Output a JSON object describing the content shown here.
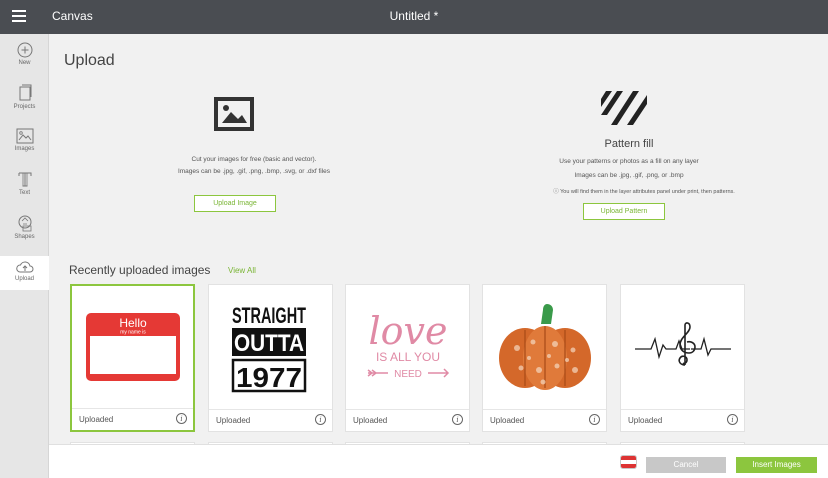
{
  "topbar": {
    "app_title": "Canvas",
    "doc_title": "Untitled *"
  },
  "sidebar": {
    "items": [
      {
        "label": "New",
        "icon": "plus-circle-icon"
      },
      {
        "label": "Projects",
        "icon": "projects-icon"
      },
      {
        "label": "Images",
        "icon": "images-icon"
      },
      {
        "label": "Text",
        "icon": "text-icon"
      },
      {
        "label": "Shapes",
        "icon": "shapes-icon"
      },
      {
        "label": "Upload",
        "icon": "upload-cloud-icon",
        "active": true
      }
    ]
  },
  "main": {
    "title": "Upload",
    "upload_image": {
      "desc1": "Cut your images for free (basic and vector).",
      "desc2": "Images can be .jpg, .gif, .png, .bmp, .svg, or .dxf files",
      "button": "Upload Image"
    },
    "pattern": {
      "title": "Pattern fill",
      "desc1": "Use your patterns or photos as a fill on any layer",
      "desc2": "Images can be .jpg, .gif, .png, or .bmp",
      "note": "ⓘ You will find them in the layer attributes panel under print, then patterns.",
      "button": "Upload Pattern"
    },
    "recent": {
      "title": "Recently uploaded images",
      "view_all": "View All",
      "cards": [
        {
          "label": "Uploaded",
          "selected": true,
          "image": "hello-name-tag",
          "hello_text": "Hello",
          "hello_sub": "my name is"
        },
        {
          "label": "Uploaded",
          "image": "straight-outta",
          "lines": [
            "STRAIGHT",
            "OUTTA",
            "1977"
          ]
        },
        {
          "label": "Uploaded",
          "image": "love-arrow",
          "lines": [
            "love",
            "IS ALL YOU",
            "NEED"
          ]
        },
        {
          "label": "Uploaded",
          "image": "pumpkin"
        },
        {
          "label": "Uploaded",
          "image": "heartbeat-treble-clef"
        }
      ]
    }
  },
  "footer": {
    "cancel": "Cancel",
    "insert": "Insert Images"
  },
  "colors": {
    "accent": "#8cc63e",
    "topbar": "#4a4d52",
    "cancel": "#c8c8c8",
    "hello_red": "#e53935",
    "love_pink": "#e08aa5",
    "pumpkin_orange": "#d4682a"
  }
}
